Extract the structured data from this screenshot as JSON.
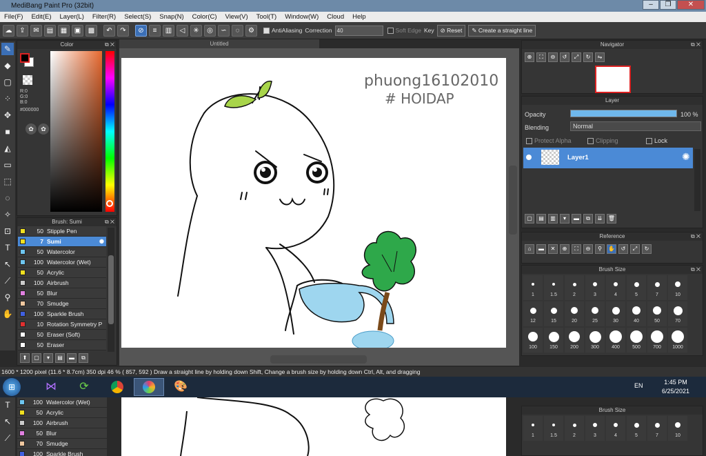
{
  "app": {
    "title": "MediBang Paint Pro (32bit)"
  },
  "menu": [
    "File(F)",
    "Edit(E)",
    "Layer(L)",
    "Filter(R)",
    "Select(S)",
    "Snap(N)",
    "Color(C)",
    "View(V)",
    "Tool(T)",
    "Window(W)",
    "Cloud",
    "Help"
  ],
  "toolbar": {
    "antialias_label": "AntiAliasing",
    "correction_label": "Correction",
    "correction_value": "40",
    "soft_edge_label": "Soft Edge",
    "key_label": "Key",
    "reset_label": "Reset",
    "straight_line_label": "Create a straight line"
  },
  "color_panel": {
    "title": "Color",
    "r": "R:0",
    "g": "G:0",
    "b": "B:0",
    "hex": "#000000"
  },
  "brush_panel": {
    "title": "Brush: Sumi",
    "items": [
      {
        "size": "50",
        "name": "Stipple Pen",
        "color": "#f0e020"
      },
      {
        "size": "7",
        "name": "Sumi",
        "color": "#f0e020",
        "selected": true
      },
      {
        "size": "50",
        "name": "Watercolor",
        "color": "#6ec6f0"
      },
      {
        "size": "100",
        "name": "Watercolor (Wet)",
        "color": "#6ec6f0"
      },
      {
        "size": "50",
        "name": "Acrylic",
        "color": "#f0e020"
      },
      {
        "size": "100",
        "name": "Airbrush",
        "color": "#cccccc"
      },
      {
        "size": "50",
        "name": "Blur",
        "color": "#e080e0"
      },
      {
        "size": "70",
        "name": "Smudge",
        "color": "#f0c8a0"
      },
      {
        "size": "100",
        "name": "Sparkle Brush",
        "color": "#4060e0"
      },
      {
        "size": "10",
        "name": "Rotation Symmetry P",
        "color": "#e03030"
      },
      {
        "size": "50",
        "name": "Eraser (Soft)",
        "color": "#ffffff"
      },
      {
        "size": "50",
        "name": "Eraser",
        "color": "#ffffff"
      }
    ]
  },
  "canvas": {
    "tab_title": "Untitled",
    "handwriting_1": "phuong16102010",
    "handwriting_2": "# HOIDAP"
  },
  "navigator": {
    "title": "Navigator"
  },
  "layer_panel": {
    "title": "Layer",
    "opacity_label": "Opacity",
    "opacity_value": "100 %",
    "opacity_fraction": 1.0,
    "blending_label": "Blending",
    "blending_value": "Normal",
    "protect_alpha_label": "Protect Alpha",
    "clipping_label": "Clipping",
    "lock_label": "Lock",
    "layer_name": "Layer1"
  },
  "reference_panel": {
    "title": "Reference"
  },
  "brush_size_panel": {
    "title": "Brush Size",
    "sizes": [
      "1",
      "1.5",
      "2",
      "3",
      "4",
      "5",
      "7",
      "10",
      "12",
      "15",
      "20",
      "25",
      "30",
      "40",
      "50",
      "70",
      "100",
      "150",
      "200",
      "300",
      "400",
      "500",
      "700",
      "1000"
    ]
  },
  "status": {
    "text": "1600 * 1200 pixel   (11.6 * 8.7cm)   350 dpi   46 %   ( 857, 592 )   Draw a straight line by holding down Shift, Change a brush size by holding down Ctrl, Alt, and dragging"
  },
  "taskbar": {
    "lang": "EN",
    "time": "1:45 PM",
    "date": "6/25/2021"
  },
  "ghost_brush": [
    {
      "size": "100",
      "name": "Watercolor (Wet)",
      "color": "#6ec6f0"
    },
    {
      "size": "50",
      "name": "Acrylic",
      "color": "#f0e020"
    },
    {
      "size": "100",
      "name": "Airbrush",
      "color": "#cccccc"
    },
    {
      "size": "50",
      "name": "Blur",
      "color": "#e080e0"
    },
    {
      "size": "70",
      "name": "Smudge",
      "color": "#f0c8a0"
    },
    {
      "size": "100",
      "name": "Sparkle Brush",
      "color": "#4060e0"
    }
  ],
  "ghost_brush_size": {
    "title": "Brush Size",
    "sizes": [
      "1",
      "1.5",
      "2",
      "3",
      "4",
      "5",
      "7",
      "10"
    ]
  }
}
